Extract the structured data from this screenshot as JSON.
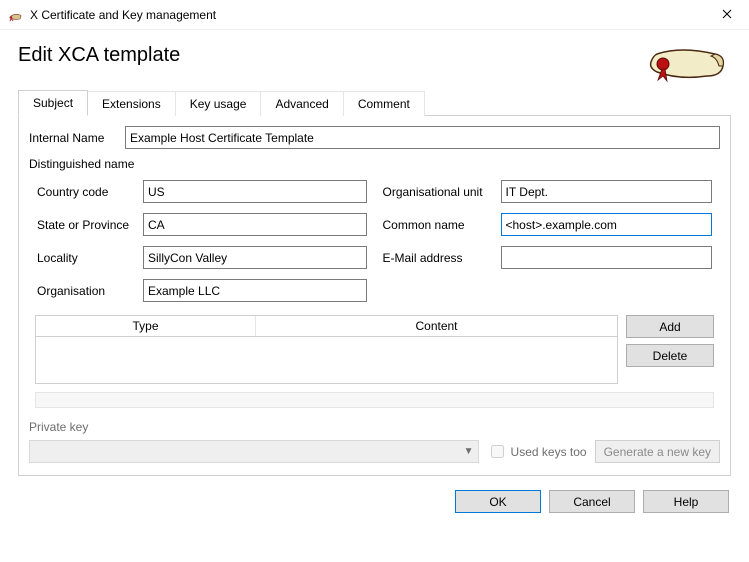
{
  "window": {
    "title": "X Certificate and Key management"
  },
  "page_title": "Edit XCA template",
  "tabs": {
    "subject": "Subject",
    "extensions": "Extensions",
    "key_usage": "Key usage",
    "advanced": "Advanced",
    "comment": "Comment"
  },
  "internal_name": {
    "label": "Internal Name",
    "value": "Example Host Certificate Template"
  },
  "dn": {
    "section_label": "Distinguished name",
    "left": {
      "country_code": {
        "label": "Country code",
        "value": "US"
      },
      "state": {
        "label": "State or Province",
        "value": "CA"
      },
      "locality": {
        "label": "Locality",
        "value": "SillyCon Valley"
      },
      "organisation": {
        "label": "Organisation",
        "value": "Example LLC"
      }
    },
    "right": {
      "org_unit": {
        "label": "Organisational unit",
        "value": "IT Dept."
      },
      "common_name": {
        "label": "Common name",
        "value": "<host>.example.com"
      },
      "email": {
        "label": "E-Mail address",
        "value": ""
      }
    }
  },
  "table": {
    "columns": {
      "type": "Type",
      "content": "Content"
    },
    "buttons": {
      "add": "Add",
      "delete": "Delete"
    }
  },
  "private_key": {
    "section_label": "Private key",
    "used_keys_too": "Used keys too",
    "generate": "Generate a new key"
  },
  "buttons": {
    "ok": "OK",
    "cancel": "Cancel",
    "help": "Help"
  }
}
